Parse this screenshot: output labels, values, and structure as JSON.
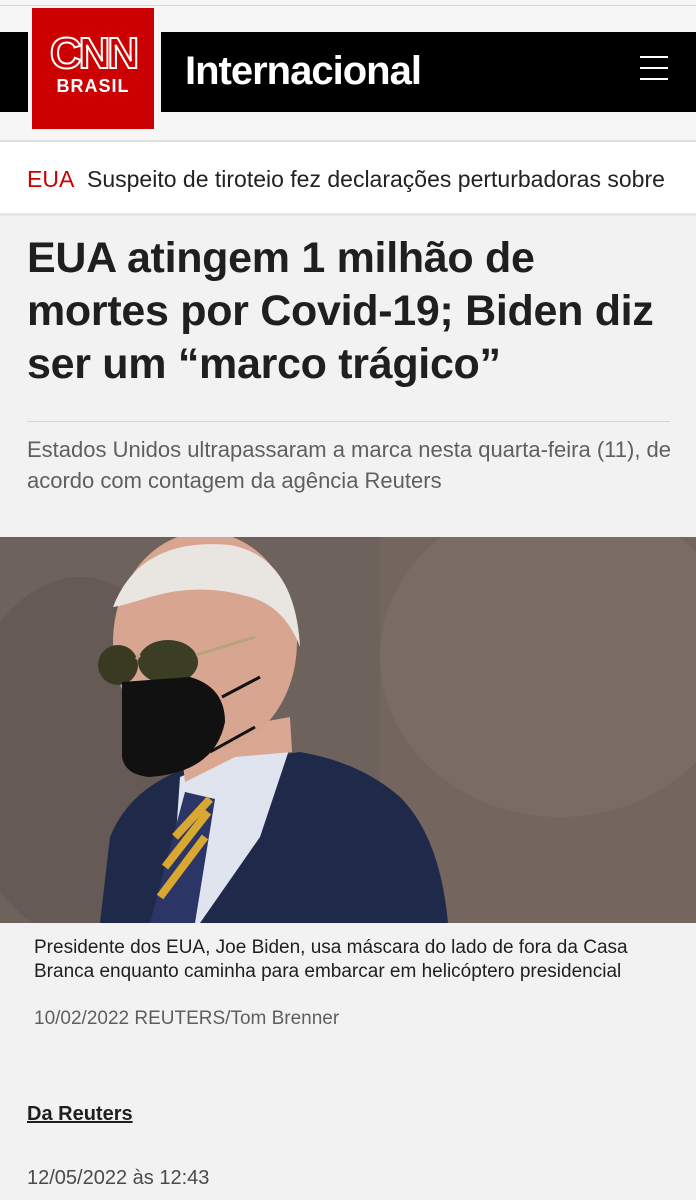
{
  "brand": {
    "logo_main": "CNN",
    "logo_sub": "BRASIL",
    "logo_color": "#cc0000"
  },
  "header": {
    "section": "Internacional"
  },
  "ticker": {
    "tag": "EUA",
    "text": "Suspeito de tiroteio fez declarações perturbadoras sobre"
  },
  "article": {
    "headline": "EUA atingem 1 milhão de mortes por Covid-19; Biden diz ser um “marco trágico”",
    "subtitle": "Estados Unidos ultrapassaram a marca nesta quarta-feira (11), de acordo com contagem da agência Reuters",
    "caption": "Presidente dos EUA, Joe Biden, usa máscara do lado de fora da Casa Branca enquanto caminha para embarcar em helicóptero presidencial",
    "credit": "10/02/2022 REUTERS/Tom Brenner",
    "byline": "Da Reuters",
    "date": "12/05/2022 às 12:43"
  },
  "icons": {
    "menu": "hamburger-menu-icon"
  }
}
